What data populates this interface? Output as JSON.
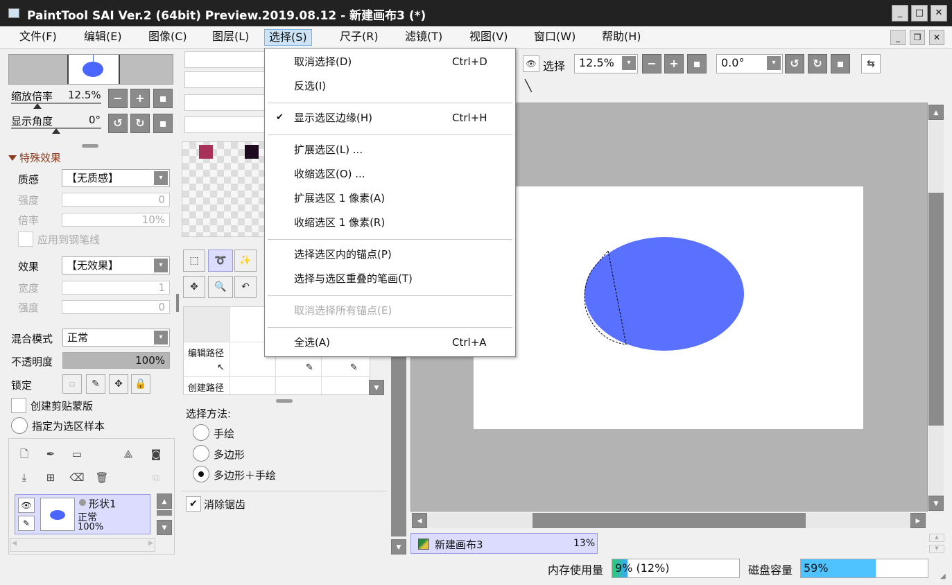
{
  "window": {
    "title": "PaintTool SAI Ver.2 (64bit) Preview.2019.08.12 - 新建画布3 (*)",
    "min": "_",
    "max": "□",
    "close": "✕"
  },
  "menubar": {
    "items": [
      {
        "label": "文件(F)"
      },
      {
        "label": "编辑(E)"
      },
      {
        "label": "图像(C)"
      },
      {
        "label": "图层(L)"
      },
      {
        "label": "选择(S)"
      },
      {
        "label": "尺子(R)"
      },
      {
        "label": "滤镜(T)"
      },
      {
        "label": "视图(V)"
      },
      {
        "label": "窗口(W)"
      },
      {
        "label": "帮助(H)"
      }
    ],
    "mdi_min": "_",
    "mdi_restore": "❐",
    "mdi_close": "✕"
  },
  "select_menu": {
    "items": [
      {
        "label": "取消选择(D)",
        "shortcut": "Ctrl+D"
      },
      {
        "label": "反选(I)",
        "shortcut": ""
      },
      {
        "label": "显示选区边缘(H)",
        "shortcut": "Ctrl+H",
        "checked": true
      },
      {
        "label": "扩展选区(L) ...",
        "shortcut": ""
      },
      {
        "label": "收缩选区(O) ...",
        "shortcut": ""
      },
      {
        "label": "扩展选区 1 像素(A)",
        "shortcut": ""
      },
      {
        "label": "收缩选区 1 像素(R)",
        "shortcut": ""
      },
      {
        "label": "选择选区内的锚点(P)",
        "shortcut": ""
      },
      {
        "label": "选择与选区重叠的笔画(T)",
        "shortcut": ""
      },
      {
        "label": "取消选择所有锚点(E)",
        "shortcut": "",
        "disabled": true
      },
      {
        "label": "全选(A)",
        "shortcut": "Ctrl+A"
      }
    ],
    "check_glyph": "✔"
  },
  "navigator": {
    "zoom_label": "缩放倍率",
    "zoom_value": "12.5%",
    "angle_label": "显示角度",
    "angle_value": "0°"
  },
  "effects": {
    "section_title": "特殊效果",
    "texture_label": "质感",
    "texture_value": "【无质感】",
    "strength_label": "强度",
    "strength_value": "0",
    "scale_label": "倍率",
    "scale_value": "10%",
    "apply_pen_label": "应用到钢笔线",
    "effect_label": "效果",
    "effect_value": "【无效果】",
    "width_label": "宽度",
    "width_value": "1",
    "strength2_label": "强度",
    "strength2_value": "0"
  },
  "layer_props": {
    "blend_label": "混合模式",
    "blend_value": "正常",
    "opacity_label": "不透明度",
    "opacity_value": "100%",
    "opacity_fraction": 1.0,
    "lock_label": "锁定",
    "clip_label": "创建剪贴蒙版",
    "sample_label": "指定为选区样本"
  },
  "layers": [
    {
      "name": "形状1",
      "mode": "正常",
      "opacity": "100%"
    }
  ],
  "swatches": {
    "colors": [
      "#a8315a",
      "#1e0a1f"
    ]
  },
  "path_table": {
    "edit_path": "编辑路径",
    "create_path": "创建路径"
  },
  "select_method": {
    "title": "选择方法:",
    "options": [
      "手绘",
      "多边形",
      "多边形＋手绘"
    ],
    "selected_index": 2,
    "antialias_label": "消除锯齿"
  },
  "toolbar": {
    "select_label": "选择",
    "zoom_value": "12.5%",
    "angle_value": "0.0°"
  },
  "canvas_tab": {
    "name": "新建画布3",
    "zoom": "13%"
  },
  "status": {
    "memory_label": "内存使用量",
    "memory_value": "9% (12%)",
    "memory_fraction": 0.09,
    "disk_label": "磁盘容量",
    "disk_value": "59%",
    "disk_fraction": 0.59
  },
  "colors": {
    "shape_fill": "#5a70ff",
    "menu_highlight": "#cde4f7",
    "layer_selected": "#dcdcff"
  }
}
